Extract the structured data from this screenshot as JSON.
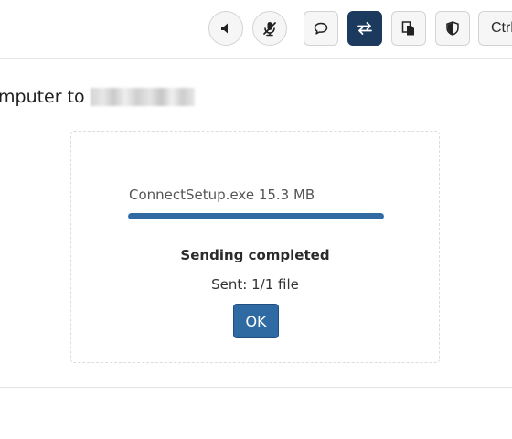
{
  "toolbar": {
    "buttons": [
      {
        "icon": "speaker-icon",
        "state": "default"
      },
      {
        "icon": "microphone-muted-icon",
        "state": "default"
      },
      {
        "icon": "chat-bubble-icon",
        "state": "default"
      },
      {
        "icon": "transfer-arrows-icon",
        "state": "active"
      },
      {
        "icon": "clipboard-icon",
        "state": "default"
      },
      {
        "icon": "shield-icon",
        "state": "default"
      }
    ],
    "ctrl_label": "Ctrl",
    "active_color": "#1c3a5e"
  },
  "heading": {
    "text": "mputer to"
  },
  "transfer": {
    "file_name": "ConnectSetup.exe 15.3 MB",
    "progress_percent": 100,
    "status_title": "Sending completed",
    "status_detail": "Sent: 1/1 file",
    "ok_label": "OK",
    "accent_color": "#2f6aa3"
  }
}
